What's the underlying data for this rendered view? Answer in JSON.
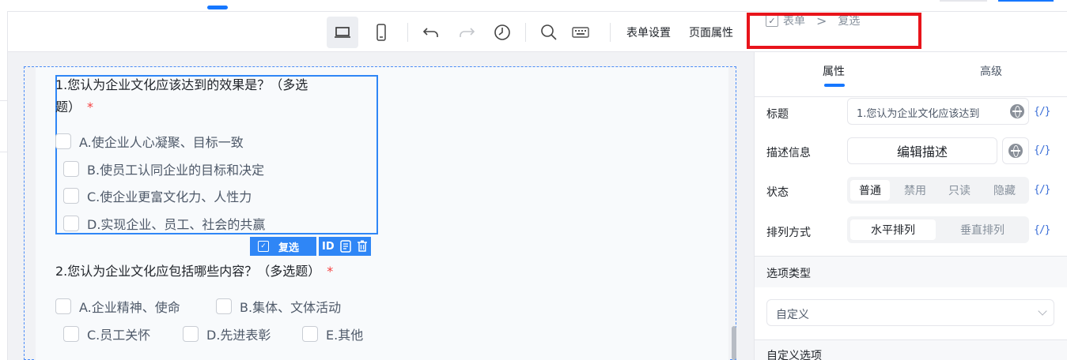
{
  "toolbar": {
    "form_settings": "表单设置",
    "page_props": "页面属性"
  },
  "breadcrumb": {
    "root": "表单",
    "separator": ">",
    "current": "复选"
  },
  "form": {
    "q1": {
      "title_line1": "1.您认为企业文化应该达到的效果是？（多选",
      "title_line2": "题）",
      "required": "*",
      "options": [
        "A.使企业人心凝聚、目标一致",
        "B.使员工认同企业的目标和决定",
        "C.使企业更富文化力、人性力",
        "D.实现企业、员工、社会的共赢"
      ]
    },
    "q2": {
      "title": "2.您认为企业文化应包括哪些内容？（多选题）",
      "required": "*",
      "options": [
        "A.企业精神、使命",
        "B.集体、文体活动",
        "C.员工关怀",
        "D.先进表彰",
        "E.其他"
      ]
    },
    "selection_tools": {
      "type_label": "复选",
      "id_label": "ID"
    }
  },
  "panel": {
    "tabs": [
      "属性",
      "高级"
    ],
    "title_label": "标题",
    "title_value": "1.您认为企业文化应该达到",
    "desc_label": "描述信息",
    "desc_button": "编辑描述",
    "status_label": "状态",
    "status_options": [
      "普通",
      "禁用",
      "只读",
      "隐藏"
    ],
    "layout_label": "排列方式",
    "layout_options": [
      "水平排列",
      "垂直排列"
    ],
    "fx": "{/}",
    "option_type_section": "选项类型",
    "option_type_value": "自定义",
    "custom_options_section": "自定义选项"
  },
  "colors": {
    "accent": "#1677ff",
    "highlight_box": "#e8141b",
    "selection": "#2f86f6",
    "required": "#f53f3f"
  }
}
